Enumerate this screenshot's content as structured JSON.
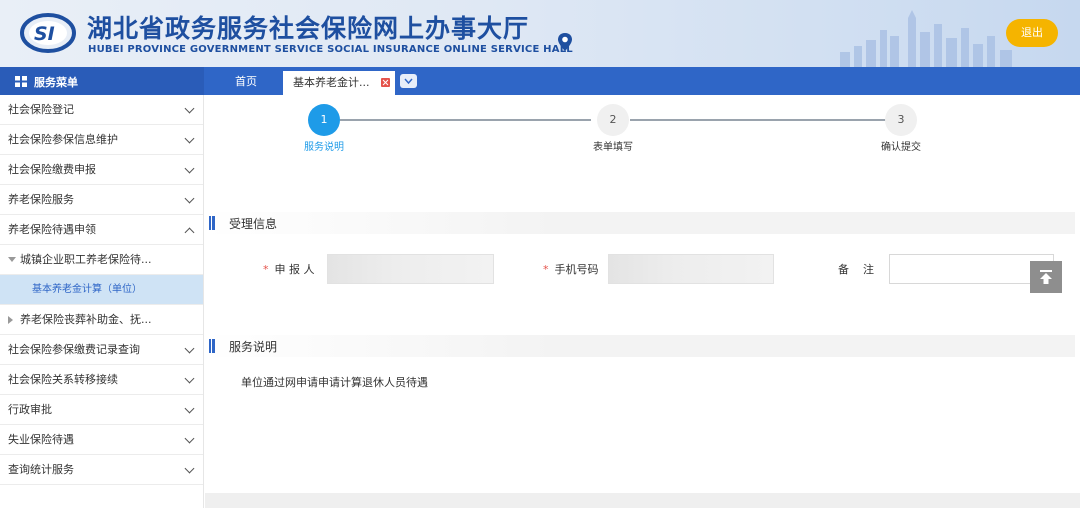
{
  "header": {
    "logo_text": "SI",
    "title_cn": "湖北省政务服务社会保险网上办事大厅",
    "title_en": "HUBEI PROVINCE GOVERNMENT SERVICE SOCIAL INSURANCE ONLINE SERVICE HALL",
    "logout_label": "退出",
    "location_icon": "map-pin-icon"
  },
  "nav": {
    "menu_title": "服务菜单",
    "tabs": [
      {
        "label": "首页"
      },
      {
        "label": "基本养老金计..."
      }
    ]
  },
  "sidebar": {
    "items": [
      {
        "label": "社会保险登记"
      },
      {
        "label": "社会保险参保信息维护"
      },
      {
        "label": "社会保险缴费申报"
      },
      {
        "label": "养老保险服务"
      },
      {
        "label": "养老保险待遇申领"
      },
      {
        "label": "城镇企业职工养老保险待..."
      },
      {
        "label": "基本养老金计算（单位）"
      },
      {
        "label": "养老保险丧葬补助金、抚..."
      },
      {
        "label": "社会保险参保缴费记录查询"
      },
      {
        "label": "社会保险关系转移接续"
      },
      {
        "label": "行政审批"
      },
      {
        "label": "失业保险待遇"
      },
      {
        "label": "查询统计服务"
      }
    ]
  },
  "steps": [
    {
      "number": "1",
      "label": "服务说明",
      "active": true
    },
    {
      "number": "2",
      "label": "表单填写",
      "active": false
    },
    {
      "number": "3",
      "label": "确认提交",
      "active": false
    }
  ],
  "sections": {
    "intake_title": "受理信息",
    "service_title": "服务说明"
  },
  "form": {
    "required_mark": "*",
    "applicant_label": "申 报 人",
    "applicant_value": "",
    "phone_label": "手机号码",
    "phone_value": "",
    "remark_label": "备    注",
    "remark_value": ""
  },
  "service_description": "单位通过网申请申请计算退休人员待遇",
  "colors": {
    "brand_blue": "#2f66c7",
    "title_blue": "#1e4fa0",
    "step_active": "#1e9be8",
    "logout_yellow": "#f5b400",
    "sidebar_selected_bg": "#cfe3f5"
  }
}
